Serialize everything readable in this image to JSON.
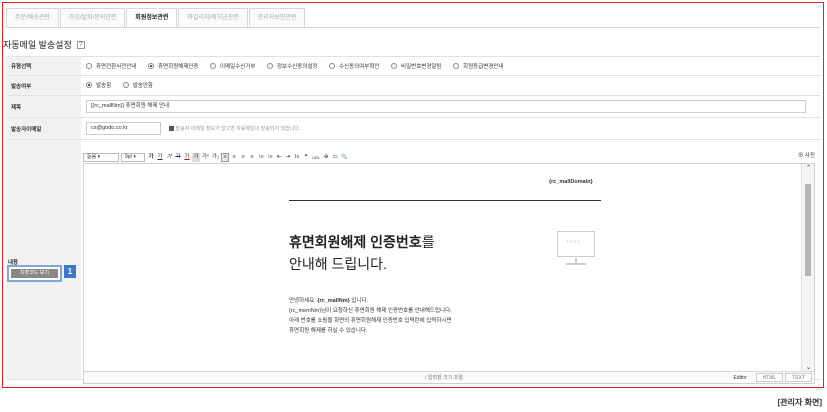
{
  "tabs": [
    {
      "label": "주문/배송관련"
    },
    {
      "label": "가입/탈퇴/문의관련"
    },
    {
      "label": "회원정보관련"
    },
    {
      "label": "마일리지/예치금관련"
    },
    {
      "label": "관리자보안관련"
    }
  ],
  "section_title": "자동메일 발송설정",
  "help_label": "?",
  "form": {
    "type_label": "유형선택",
    "type_options": [
      {
        "label": "휴면전환사전안내",
        "selected": false
      },
      {
        "label": "휴면회원해제인증",
        "selected": true
      },
      {
        "label": "이메일수신거부",
        "selected": false
      },
      {
        "label": "정보수신동의설정",
        "selected": false
      },
      {
        "label": "수신동의여부확인",
        "selected": false
      },
      {
        "label": "비밀번호변경알림",
        "selected": false
      },
      {
        "label": "회원등급변경안내",
        "selected": false
      }
    ],
    "send_label": "발송여부",
    "send_options": [
      {
        "label": "발송함",
        "selected": true
      },
      {
        "label": "발송안함",
        "selected": false
      }
    ],
    "subject_label": "제목",
    "subject_value": "[{rc_mallNm}] 휴면회원 해제 안내",
    "sender_label": "발송자이메일",
    "sender_value": "cs@godo.co.kr",
    "sender_note": "발송자 이메일 정보가 없으면 자동메일이 발송되지 않습니다.",
    "content_label": "내용",
    "source_button": "치환코드 보기",
    "badge_number": "1"
  },
  "editor": {
    "font_select": "돋움",
    "size_select": "9pt",
    "toolbar_buttons": [
      "가",
      "가",
      "가",
      "가",
      "가",
      "가",
      "가²",
      "가₂",
      "≡",
      "≡",
      "≡",
      "≡",
      "⁝≡",
      "⁝≡",
      "⇤",
      "⇥",
      "Ix",
      "❝",
      "URL",
      "⊕",
      "▭",
      "🔍"
    ],
    "preview_label": "사진",
    "domain_code": "{rc_mallDomain}",
    "headline_bold": "휴면회원해제 인증번호",
    "headline_rest": "를",
    "subhead": "안내해 드립니다.",
    "monitor_text": "****",
    "greeting_prefix": "안녕하세요.",
    "greeting_code": "{rc_mallNm}",
    "greeting_suffix": "입니다.",
    "body_lines": [
      "{rc_memNm}님이 요청하신 휴면회원 해제 인증번호를 안내해드립니다.",
      "아래 번호를 쇼핑몰 화면의 휴면회원해제 인증번호 입력란에 입력하시면",
      "휴면회원 해제를 하실 수 있습니다."
    ],
    "resize_label": "↕ 입력창 크기 조절",
    "modes": [
      "Editor",
      "HTML",
      "TEXT"
    ]
  },
  "caption": "[관리자 화면]"
}
